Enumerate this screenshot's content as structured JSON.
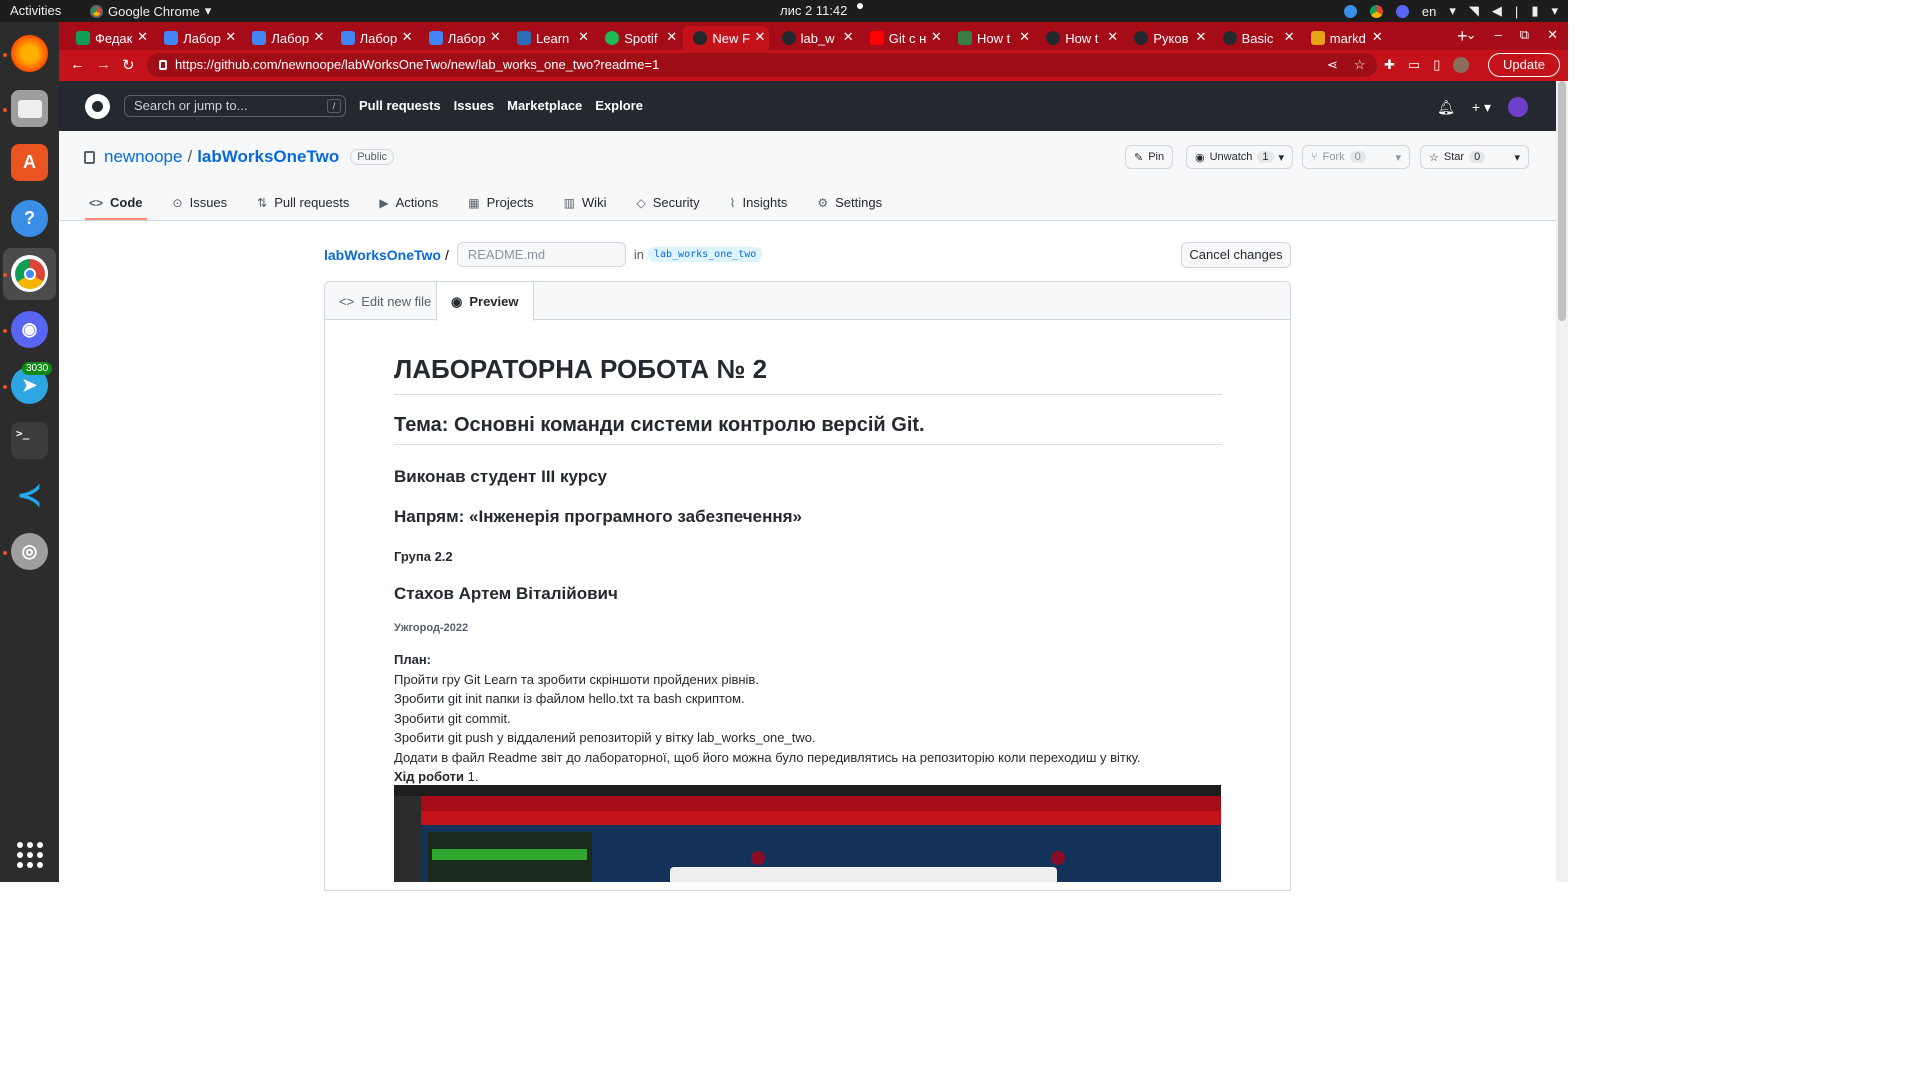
{
  "system_bar": {
    "activities": "Activities",
    "app": "Google Chrome",
    "clock": "лис 2  11:42",
    "lang": "en"
  },
  "dock": {
    "telegram_badge": "3030"
  },
  "tabs": [
    {
      "label": "Федак",
      "favicon": "drive",
      "color": "#0f9d58"
    },
    {
      "label": "Лабор",
      "favicon": "docs",
      "color": "#4285f4"
    },
    {
      "label": "Лабор",
      "favicon": "docs",
      "color": "#4285f4"
    },
    {
      "label": "Лабор",
      "favicon": "docs",
      "color": "#4285f4"
    },
    {
      "label": "Лабор",
      "favicon": "docs",
      "color": "#4285f4"
    },
    {
      "label": "Learn",
      "favicon": "learngit",
      "color": "#2c6db5"
    },
    {
      "label": "Spotif",
      "favicon": "spotify",
      "color": "#1db954"
    },
    {
      "label": "New F",
      "favicon": "github",
      "color": "#24292f"
    },
    {
      "label": "lab_w",
      "favicon": "github",
      "color": "#24292f"
    },
    {
      "label": "Git с н",
      "favicon": "youtube",
      "color": "#ff0000"
    },
    {
      "label": "How t",
      "favicon": "stack",
      "color": "#3a7d44"
    },
    {
      "label": "How t",
      "favicon": "github",
      "color": "#24292f"
    },
    {
      "label": "Руков",
      "favicon": "github",
      "color": "#24292f"
    },
    {
      "label": "Basic",
      "favicon": "github",
      "color": "#24292f"
    },
    {
      "label": "markd",
      "favicon": "markdown",
      "color": "#e8a317"
    }
  ],
  "browser": {
    "url": "https://github.com/newnoope/labWorksOneTwo/new/lab_works_one_two?readme=1",
    "update_label": "Update"
  },
  "github": {
    "search_placeholder": "Search or jump to...",
    "search_key": "/",
    "nav": [
      "Pull requests",
      "Issues",
      "Marketplace",
      "Explore"
    ]
  },
  "repo": {
    "owner": "newnoope",
    "name": "labWorksOneTwo",
    "visibility": "Public",
    "pin_label": "Pin",
    "watch_label": "Unwatch",
    "watch_count": "1",
    "fork_label": "Fork",
    "fork_count": "0",
    "star_label": "Star",
    "star_count": "0",
    "tabs": [
      "Code",
      "Issues",
      "Pull requests",
      "Actions",
      "Projects",
      "Wiki",
      "Security",
      "Insights",
      "Settings"
    ]
  },
  "editor": {
    "repo_crumb": "labWorksOneTwo",
    "crumb_sep": "/",
    "filename_placeholder": "README.md",
    "in_word": "in",
    "branch": "lab_works_one_two",
    "cancel_label": "Cancel changes",
    "tab_edit": "Edit new file",
    "tab_preview": "Preview"
  },
  "preview": {
    "h1": "ЛАБОРАТОРНА РОБОТА № 2",
    "h2": "Тема: Основні команди системи контролю версій Git.",
    "h3_student": "Виконав студент III курсу",
    "h3_direction": "Напрям: «Інженерія програмного забезпечення»",
    "h4_group": "Група 2.2",
    "h3_name": "Стахов Артем Віталійович",
    "h6_city": "Ужгород-2022",
    "plan_title": "План:",
    "plan_items": [
      "Пройти гру Git Learn та зробити скріншоти пройдених рівнів.",
      "Зробити git init папки із файлом hello.txt та bash скриптом.",
      "Зробити git commit.",
      "Зробити git push у віддалений репозиторій у вітку lab_works_one_two.",
      "Додати в файл Readme звіт до лабораторної, щоб його можна було передивлятись на репозиторію коли переходиш у вітку."
    ],
    "progress_title": "Хід роботи",
    "progress_num": "1."
  },
  "screenshot_image": {
    "alt": "Screenshot of Learn Git Branching in Chrome"
  }
}
